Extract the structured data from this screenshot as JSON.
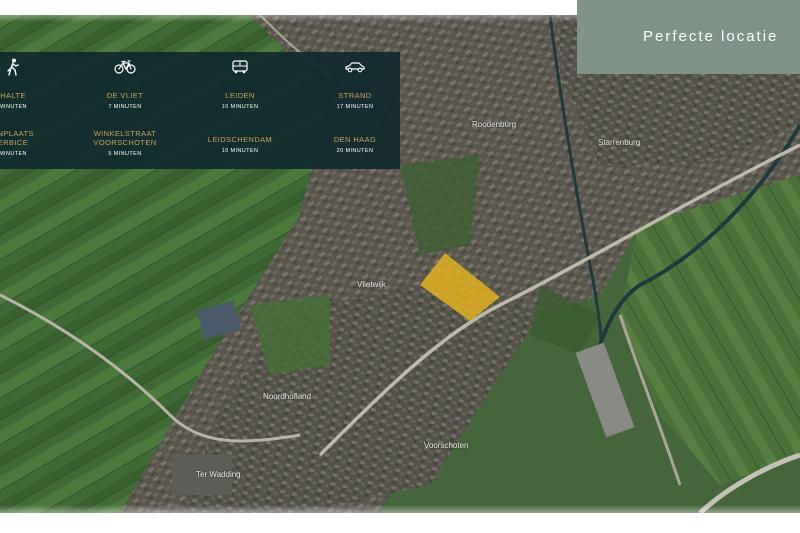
{
  "title": "Perfecte locatie",
  "colors": {
    "panel": "#102a2e",
    "accent_gold": "#c8a45a",
    "title_box": "#7f9388",
    "highlight_area": "#e6b41e"
  },
  "icons": [
    "walking-icon",
    "bicycle-icon",
    "bus-icon",
    "car-icon"
  ],
  "travel": {
    "walk": {
      "dest1": "HALTE",
      "time1": "MINUTEN",
      "dest2a": "ENPLAATS",
      "dest2b": "ERBICE",
      "time2": "MINUTEN"
    },
    "bike": {
      "dest1": "DE VLIET",
      "time1": "7 MINUTEN",
      "dest2a": "WINKELSTRAAT",
      "dest2b": "VOORSCHOTEN",
      "time2": "5 MINUTEN"
    },
    "bus": {
      "dest1": "LEIDEN",
      "time1": "10 MINUTEN",
      "dest2": "LEIDSCHENDAM",
      "time2": "10 MINUTEN"
    },
    "car": {
      "dest1": "STRAND",
      "time1": "17 MINUTEN",
      "dest2": "DEN HAAG",
      "time2": "20 MINUTEN"
    }
  }
}
